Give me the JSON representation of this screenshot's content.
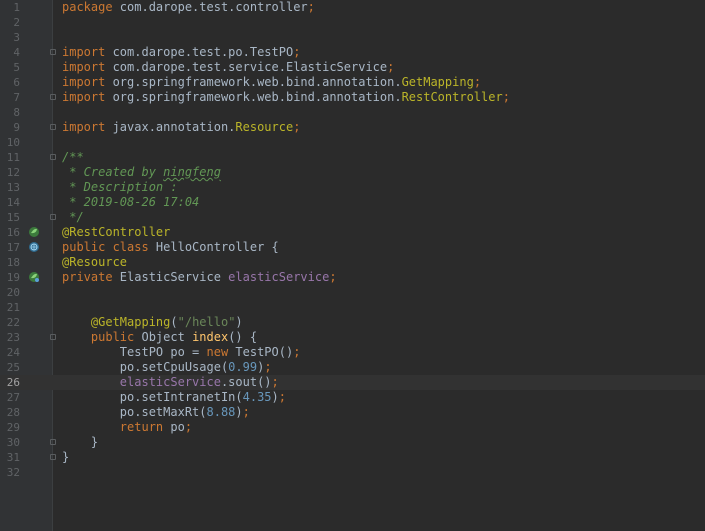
{
  "editor": {
    "current_line": 26,
    "lines": [
      {
        "n": "1",
        "tokens": [
          [
            "kw",
            "package "
          ],
          [
            "pkg",
            "com.darope.test.controller"
          ],
          [
            "punc",
            ";"
          ]
        ]
      },
      {
        "n": "2",
        "tokens": []
      },
      {
        "n": "3",
        "tokens": []
      },
      {
        "n": "4",
        "tokens": [
          [
            "kw",
            "import "
          ],
          [
            "pkg",
            "com.darope.test.po.TestPO"
          ],
          [
            "punc",
            ";"
          ]
        ],
        "fold": true
      },
      {
        "n": "5",
        "tokens": [
          [
            "kw",
            "import "
          ],
          [
            "pkg",
            "com.darope.test.service.ElasticService"
          ],
          [
            "punc",
            ";"
          ]
        ]
      },
      {
        "n": "6",
        "tokens": [
          [
            "kw",
            "import "
          ],
          [
            "pkg",
            "org.springframework.web.bind.annotation."
          ],
          [
            "ann",
            "GetMapping"
          ],
          [
            "punc",
            ";"
          ]
        ]
      },
      {
        "n": "7",
        "tokens": [
          [
            "kw",
            "import "
          ],
          [
            "pkg",
            "org.springframework.web.bind.annotation."
          ],
          [
            "ann",
            "RestController"
          ],
          [
            "punc",
            ";"
          ]
        ],
        "fold": true
      },
      {
        "n": "8",
        "tokens": []
      },
      {
        "n": "9",
        "tokens": [
          [
            "kw",
            "import "
          ],
          [
            "pkg",
            "javax.annotation."
          ],
          [
            "ann",
            "Resource"
          ],
          [
            "punc",
            ";"
          ]
        ],
        "fold": true
      },
      {
        "n": "10",
        "tokens": []
      },
      {
        "n": "11",
        "tokens": [
          [
            "cmt",
            "/**"
          ]
        ],
        "fold": true
      },
      {
        "n": "12",
        "tokens": [
          [
            "cmt",
            " * Created by "
          ],
          [
            "cmt-tag",
            "ningfeng"
          ]
        ]
      },
      {
        "n": "13",
        "tokens": [
          [
            "cmt",
            " * Description :"
          ]
        ]
      },
      {
        "n": "14",
        "tokens": [
          [
            "cmt",
            " * 2019-08-26 17:04"
          ]
        ]
      },
      {
        "n": "15",
        "tokens": [
          [
            "cmt",
            " */"
          ]
        ],
        "fold": true
      },
      {
        "n": "16",
        "tokens": [
          [
            "ann",
            "@RestController"
          ]
        ],
        "icon": "spring-bean-icon"
      },
      {
        "n": "17",
        "tokens": [
          [
            "kw",
            "public class "
          ],
          [
            "cls",
            "HelloController "
          ],
          [
            "plain",
            "{"
          ]
        ],
        "icon": "spring-web-icon"
      },
      {
        "n": "18",
        "tokens": [
          [
            "ann",
            "@Resource"
          ]
        ]
      },
      {
        "n": "19",
        "tokens": [
          [
            "kw",
            "private "
          ],
          [
            "cls",
            "ElasticService "
          ],
          [
            "fld",
            "elasticService"
          ],
          [
            "punc",
            ";"
          ]
        ],
        "icon": "autowired-icon"
      },
      {
        "n": "20",
        "tokens": []
      },
      {
        "n": "21",
        "tokens": []
      },
      {
        "n": "22",
        "tokens": [
          [
            "plain",
            "    "
          ],
          [
            "ann",
            "@GetMapping"
          ],
          [
            "plain",
            "("
          ],
          [
            "str",
            "\"/hello\""
          ],
          [
            "plain",
            ")"
          ]
        ]
      },
      {
        "n": "23",
        "tokens": [
          [
            "plain",
            "    "
          ],
          [
            "kw",
            "public "
          ],
          [
            "cls",
            "Object "
          ],
          [
            "mth",
            "index"
          ],
          [
            "plain",
            "() {"
          ]
        ],
        "fold": true
      },
      {
        "n": "24",
        "tokens": [
          [
            "plain",
            "        TestPO po = "
          ],
          [
            "kw",
            "new "
          ],
          [
            "plain",
            "TestPO()"
          ],
          [
            "punc",
            ";"
          ]
        ]
      },
      {
        "n": "25",
        "tokens": [
          [
            "plain",
            "        po.setCpuUsage("
          ],
          [
            "num",
            "0.99"
          ],
          [
            "plain",
            ")"
          ],
          [
            "punc",
            ";"
          ]
        ]
      },
      {
        "n": "26",
        "tokens": [
          [
            "plain",
            "        "
          ],
          [
            "fld",
            "elasticService"
          ],
          [
            "plain",
            ".sout()"
          ],
          [
            "punc",
            ";"
          ]
        ]
      },
      {
        "n": "27",
        "tokens": [
          [
            "plain",
            "        po.setIntranetIn("
          ],
          [
            "num",
            "4.35"
          ],
          [
            "plain",
            ")"
          ],
          [
            "punc",
            ";"
          ]
        ]
      },
      {
        "n": "28",
        "tokens": [
          [
            "plain",
            "        po.setMaxRt("
          ],
          [
            "num",
            "8.88"
          ],
          [
            "plain",
            ")"
          ],
          [
            "punc",
            ";"
          ]
        ]
      },
      {
        "n": "29",
        "tokens": [
          [
            "plain",
            "        "
          ],
          [
            "kw",
            "return "
          ],
          [
            "plain",
            "po"
          ],
          [
            "punc",
            ";"
          ]
        ]
      },
      {
        "n": "30",
        "tokens": [
          [
            "plain",
            "    }"
          ]
        ],
        "fold": true
      },
      {
        "n": "31",
        "tokens": [
          [
            "plain",
            "}"
          ]
        ],
        "fold": true
      },
      {
        "n": "32",
        "tokens": []
      }
    ]
  },
  "colors": {
    "background": "#2b2b2b",
    "gutter": "#313335",
    "keyword": "#cc7832",
    "annotation": "#bbb529",
    "field": "#9876aa",
    "string": "#6a8759",
    "number": "#6897bb",
    "comment": "#629755",
    "method": "#ffc66d",
    "text": "#a9b7c6"
  }
}
